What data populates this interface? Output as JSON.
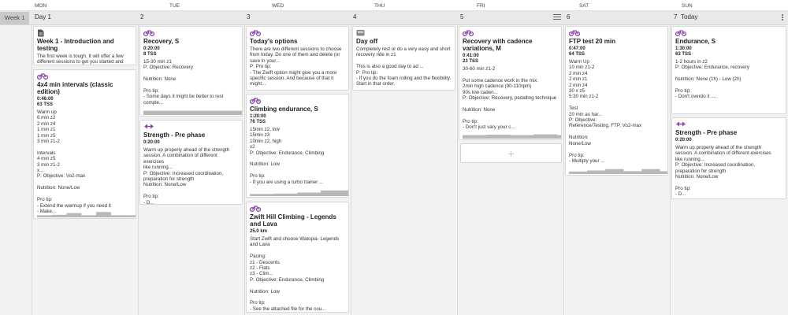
{
  "days": [
    "MON",
    "TUE",
    "WED",
    "THU",
    "FRI",
    "SAT",
    "SUN"
  ],
  "week": {
    "label": "Week 1",
    "dates": [
      "Day 1",
      "2",
      "3",
      "4",
      "5",
      "6",
      "7",
      "Today"
    ]
  },
  "colors": {
    "accent": "#8e44ad",
    "card_bg": "#ffffff",
    "graph": "#b8b8b8"
  },
  "add_slot": {
    "label": "+"
  },
  "workouts": [
    {
      "icon": "document-icon",
      "title": "Week 1 - Introduction and testing",
      "duration": "",
      "tss": "",
      "body": "The first week is tough. It will offer a few\ndifferent sessions to get you started and\nready. It ..."
    },
    {
      "icon": "bike-icon",
      "title": "4x4 min intervals (classic edition)",
      "duration": "0:46:00",
      "tss": "63 TSS",
      "body": "Warm up\n6 min z2\n2 min z4\n1 min z1\n1 min z5\n3 min z1-2\n\nIntervals\n4 min z5\n3 min z1-2\nx...\nP: Objective: Vo2-max\n\nNutrition: None/Low\n\nPro tip:\n- Extend the warmup if you need it\n- Make...",
      "graph": [
        0.3,
        0.35,
        0.6,
        0.3,
        0.75,
        0.3,
        0.3,
        0.8,
        0.3,
        0.8,
        0.3,
        0.8,
        0.3,
        0.8,
        0.3,
        0.3
      ]
    },
    {
      "icon": "bike-icon",
      "title": "Recovery, S",
      "duration": "0:20:00",
      "tss": "8 TSS",
      "body": "15-30 min z1\nP: Objective: Recovery\n\nNutrition: None\n\nPro tip:\n- Some days it might be better to rest\ncomple...",
      "graph": [
        0.6,
        0.6,
        0.6,
        0.6
      ]
    },
    {
      "icon": "strength-icon",
      "title": "Strength - Pre phase",
      "duration": "0:20:00",
      "tss": "",
      "body": "Warm up properly ahead of the strength\nsession. A combination of different exercises\nlike running...\nP: Objective: Increased coordination,\npreparation for strength\nNutrition: None/Low\n\nPro tip:\n- D..."
    },
    {
      "icon": "bike-icon",
      "title": "Today's options",
      "duration": "",
      "tss": "",
      "body": "There are two different sessions to choose\nfrom today. Do one of them and delete (or\nsave in your...\nP: Pro tip:\n- The Zwift option might give you a more\nspecific session. And because of that it\nmight..."
    },
    {
      "icon": "bike-icon",
      "title": "Climbing endurance, S",
      "duration": "1:20:00",
      "tss": "76 TSS",
      "body": "15min z2, low\n15min z3\n10min z2, high\nx2\nP: Objective: Endurance, Climbing\n\nNutrition: Low\n\nPro tip:\n- If you are using a turbo trainer ...",
      "graph": [
        0.3,
        0.35,
        0.5,
        0.8,
        0.8,
        0.6,
        0.8,
        0.8,
        0.6,
        0.35
      ]
    },
    {
      "icon": "bike-icon",
      "title": "Zwift Hill Climbing - Legends and Lava",
      "duration": "25.0 km",
      "tss": "",
      "body": "Start Zwift and choose Watopia- Legends\nand Lava\n\nPacing:\nz1 - Descents\nz2 - Flats\nz3 - Clim...\nP: Objective: Endurance, Climbing\n\nNutrition: Low\n\nPro tip:\n- See the attached file for the cou..."
    },
    {
      "icon": "rest-icon",
      "title": "Day off",
      "duration": "",
      "tss": "",
      "body": "Completely rest or do a very easy and short\nrecovery ride in z1\n\nThis is also a good day to ad ...\nP: Pro tip:\n- If you do the foam rolling and the flexibility.\nStart in that order."
    },
    {
      "icon": "bike-icon",
      "title": "Recovery with cadence variations, M",
      "duration": "0:41:00",
      "tss": "23 TSS",
      "body": "30-60 min z1-2\n\nPut some cadence work in the mix:\n2min high cadence (90-110rpm)\n90s low caden...\nP: Objective: Recovery, pedalling technique\n\nNutrition: None\n\nPro tip:\n- Don't just vary your c...",
      "graph": [
        0.5,
        0.55,
        0.5,
        0.6,
        0.5,
        0.6,
        0.5,
        0.6,
        0.5,
        0.5
      ]
    },
    {
      "icon": "bike-icon",
      "title": "FTP test 20 min",
      "duration": "0:47:00",
      "tss": "64 TSS",
      "body": "Warm Up\n10 min z1-2\n2 min z4\n2 min z1\n2 min z4\n30 x z5\n5:30 min z1-2\n\nTest\n20 min as har...\nP: Objective:\nReference/Testing, FTP, Vo2-max\n\nNutrition:\nNone/Low\n\nPro tip:\n- Multiply your ...",
      "graph": [
        0.35,
        0.5,
        0.7,
        0.4,
        0.7,
        0.4,
        0.9,
        0.4,
        0.85,
        0.85,
        0.85,
        0.85,
        0.35
      ]
    },
    {
      "icon": "bike-icon",
      "title": "Endurance, S",
      "duration": "1:30:00",
      "tss": "63 TSS",
      "body": "1-2 hours in z2\nP: Objective: Endurance, recovery\n\nNutrition: None (1h) - Low (2h)\n\nPro tip:\n- Don't overdo it ...."
    },
    {
      "icon": "strength-icon",
      "title": "Strength - Pre phase",
      "duration": "0:20:00",
      "tss": "",
      "body": "Warm up properly ahead of the strength\nsession. A combination of different exercises\nlike running...\nP: Objective: Increased coordination,\npreparation for strength\nNutrition: None/Low\n\nPro tip:\n- D..."
    }
  ]
}
